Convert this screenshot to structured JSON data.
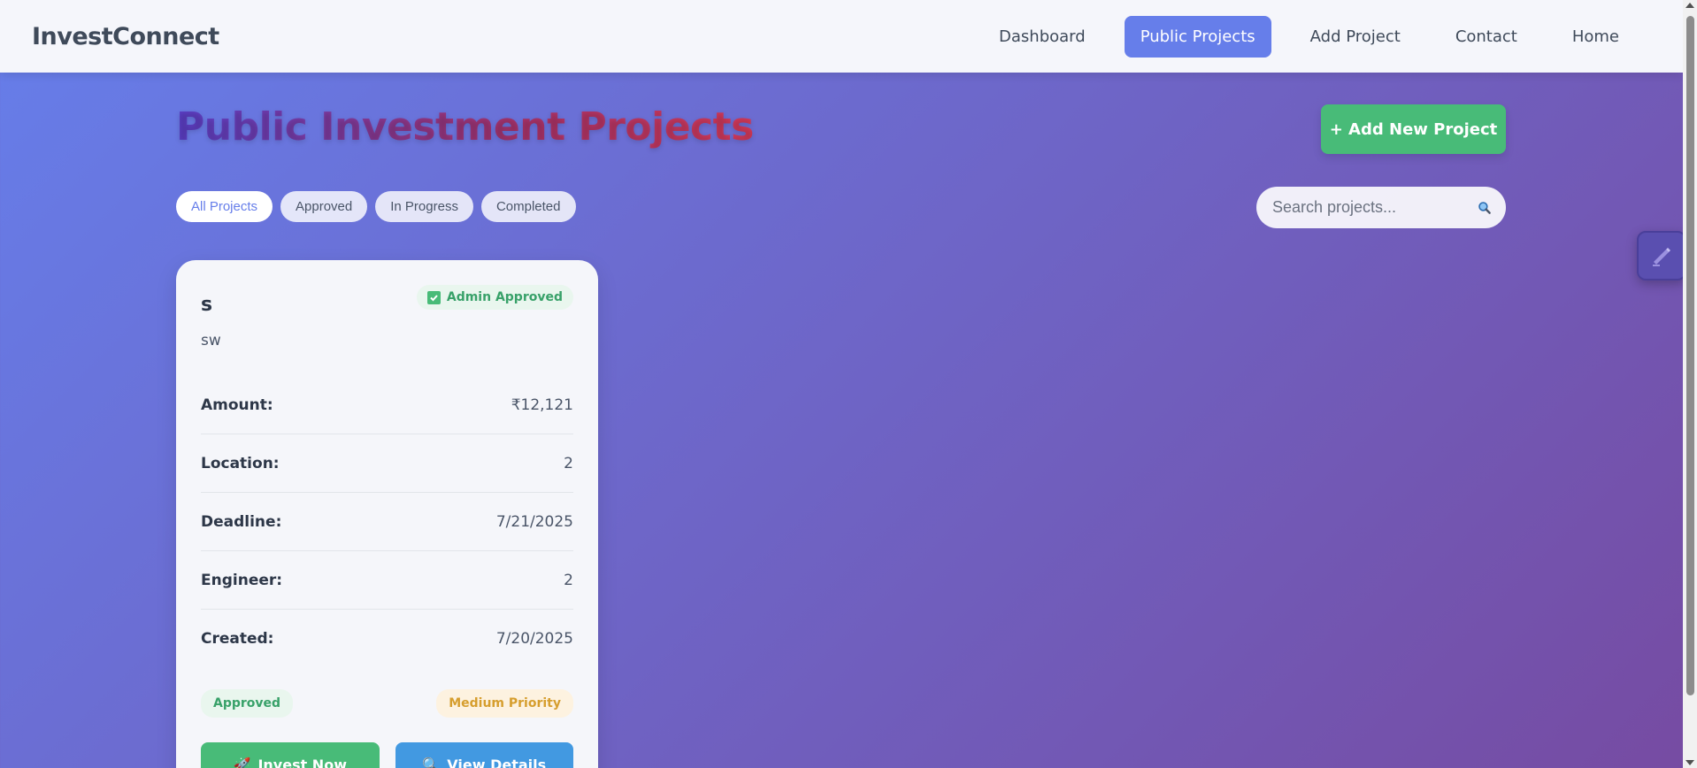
{
  "navbar": {
    "brand": "InvestConnect",
    "links": [
      {
        "label": "Dashboard",
        "active": false
      },
      {
        "label": "Public Projects",
        "active": true
      },
      {
        "label": "Add Project",
        "active": false
      },
      {
        "label": "Contact",
        "active": false
      },
      {
        "label": "Home",
        "active": false
      }
    ]
  },
  "header": {
    "title": "Public Investment Projects",
    "add_button": "+ Add New Project"
  },
  "filters": [
    "All Projects",
    "Approved",
    "In Progress",
    "Completed"
  ],
  "active_filter": "All Projects",
  "search": {
    "placeholder": "Search projects...",
    "value": "",
    "icon": "search-icon"
  },
  "floating_button": {
    "icon": "edit-icon"
  },
  "project": {
    "title": "s",
    "admin_badge": "Admin Approved",
    "description": "sw",
    "rows": [
      {
        "label": "Amount:",
        "value": "₹12,121"
      },
      {
        "label": "Location:",
        "value": "2"
      },
      {
        "label": "Deadline:",
        "value": "7/21/2025"
      },
      {
        "label": "Engineer:",
        "value": "2"
      },
      {
        "label": "Created:",
        "value": "7/20/2025"
      }
    ],
    "status": "Approved",
    "priority": "Medium Priority",
    "invest_button": "Invest Now",
    "view_button": "View Details"
  },
  "colors": {
    "accent": "#667eea",
    "success": "#48bb78",
    "info": "#4299e1",
    "gradient_start": "#667eea",
    "gradient_end": "#764ba2"
  }
}
